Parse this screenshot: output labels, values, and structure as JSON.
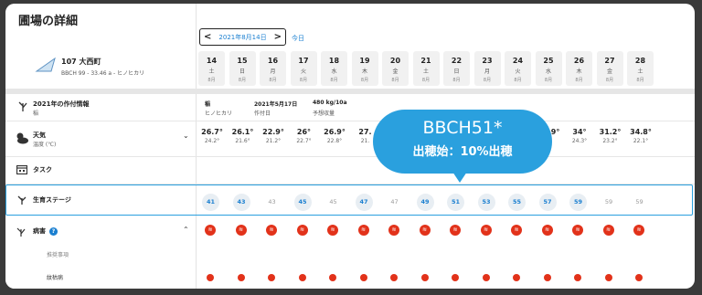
{
  "page_title": "圃場の詳細",
  "date_picker": {
    "value": "2021年8月14日",
    "prev": "<",
    "next": ">"
  },
  "today_label": "今日",
  "field": {
    "name": "107 大西町",
    "sub": "BBCH 99 - 33.46 a - ヒノヒカリ"
  },
  "days": [
    {
      "num": "14",
      "wd": "土",
      "mo": "8月"
    },
    {
      "num": "15",
      "wd": "日",
      "mo": "8月"
    },
    {
      "num": "16",
      "wd": "月",
      "mo": "8月"
    },
    {
      "num": "17",
      "wd": "火",
      "mo": "8月"
    },
    {
      "num": "18",
      "wd": "水",
      "mo": "8月"
    },
    {
      "num": "19",
      "wd": "木",
      "mo": "8月"
    },
    {
      "num": "20",
      "wd": "金",
      "mo": "8月"
    },
    {
      "num": "21",
      "wd": "土",
      "mo": "8月"
    },
    {
      "num": "22",
      "wd": "日",
      "mo": "8月"
    },
    {
      "num": "23",
      "wd": "月",
      "mo": "8月"
    },
    {
      "num": "24",
      "wd": "火",
      "mo": "8月"
    },
    {
      "num": "25",
      "wd": "水",
      "mo": "8月"
    },
    {
      "num": "26",
      "wd": "木",
      "mo": "8月"
    },
    {
      "num": "27",
      "wd": "金",
      "mo": "8月"
    },
    {
      "num": "28",
      "wd": "土",
      "mo": "8月"
    }
  ],
  "crop_info": {
    "label": "2021年の作付情報",
    "sub": "稲",
    "crop": "稲",
    "variety": "ヒノヒカリ",
    "date": "2021年5月17日",
    "date_label": "作付日",
    "yield": "480 kg/10a",
    "yield_label": "予想収量"
  },
  "weather": {
    "label": "天気",
    "sub": "温度 (℃)",
    "hi": [
      "26.7°",
      "26.1°",
      "22.9°",
      "26°",
      "26.9°",
      "27.",
      "",
      "",
      "",
      "",
      "30.9°",
      "34°",
      "31.2°",
      "34.8°"
    ],
    "lo": [
      "24.2°",
      "21.6°",
      "21.2°",
      "22.7°",
      "22.8°",
      "21.",
      "",
      "",
      "",
      "",
      "",
      "24.3°",
      "23.2°",
      "22.1°"
    ]
  },
  "task_label": "タスク",
  "stage": {
    "label": "生育ステージ",
    "values": [
      "41",
      "43",
      "43",
      "45",
      "45",
      "47",
      "47",
      "49",
      "51",
      "53",
      "55",
      "57",
      "59",
      "59",
      "59"
    ],
    "highlight": [
      true,
      true,
      false,
      true,
      false,
      true,
      false,
      true,
      true,
      true,
      true,
      true,
      true,
      false,
      false
    ]
  },
  "disease": {
    "label": "病害",
    "help": "?",
    "sub1": "推奨事項",
    "sub2": "紋枯病",
    "icon_glyph": "≋"
  },
  "bubble": {
    "line1": "BBCH51*",
    "line2": "出穂始：10%出穂"
  },
  "colors": {
    "accent": "#2aa0de",
    "link": "#1a7fd0",
    "risk": "#e2321a"
  }
}
